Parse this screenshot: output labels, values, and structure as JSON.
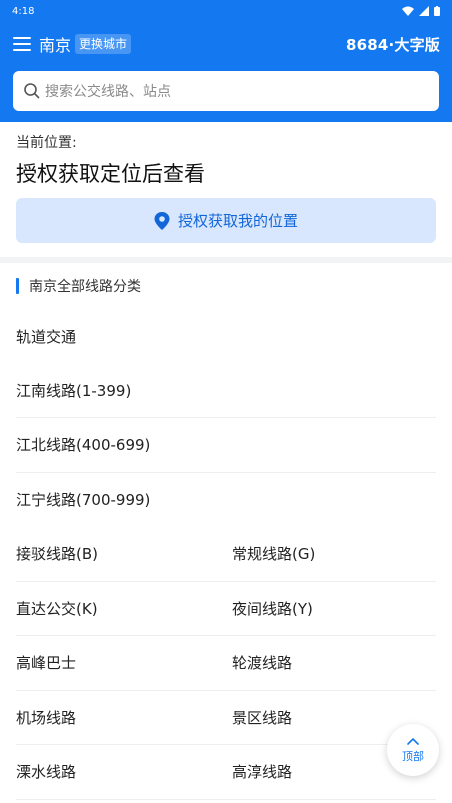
{
  "status_bar": {
    "time": "4:18"
  },
  "header": {
    "city": "南京",
    "change_city": "更换城市",
    "brand": "8684·大字版"
  },
  "search": {
    "placeholder": "搜索公交线路、站点"
  },
  "location": {
    "label": "当前位置:",
    "title": "授权获取定位后查看",
    "button": "授权获取我的位置"
  },
  "categories": {
    "header": "南京全部线路分类",
    "single_items": [
      "轨道交通",
      "江南线路(1-399)",
      "江北线路(400-699)",
      "江宁线路(700-999)"
    ],
    "pairs": [
      [
        "接驳线路(B)",
        "常规线路(G)"
      ],
      [
        "直达公交(K)",
        "夜间线路(Y)"
      ],
      [
        "高峰巴士",
        "轮渡线路"
      ],
      [
        "机场线路",
        "景区线路"
      ],
      [
        "溧水线路",
        "高淳线路"
      ]
    ]
  },
  "top_button": {
    "label": "顶部"
  },
  "colors": {
    "accent": "#1479f0",
    "button_bg": "#d8e7fd"
  }
}
